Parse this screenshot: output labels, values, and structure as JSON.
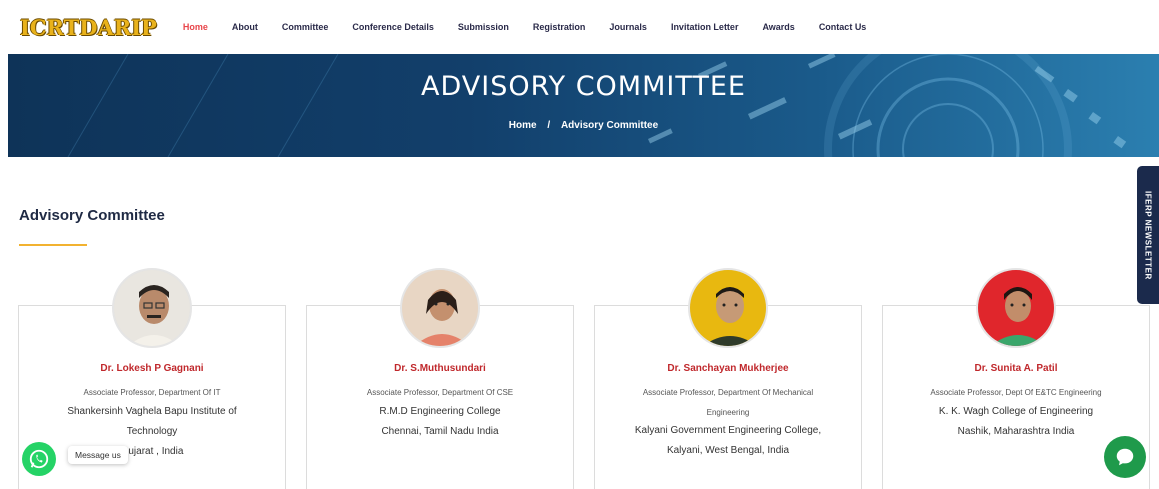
{
  "site": {
    "logo": "ICRTDARIP"
  },
  "nav": [
    {
      "label": "Home",
      "active": true
    },
    {
      "label": "About"
    },
    {
      "label": "Committee"
    },
    {
      "label": "Conference Details"
    },
    {
      "label": "Submission"
    },
    {
      "label": "Registration"
    },
    {
      "label": "Journals"
    },
    {
      "label": "Invitation Letter"
    },
    {
      "label": "Awards"
    },
    {
      "label": "Contact Us"
    }
  ],
  "banner": {
    "title": "ADVISORY COMMITTEE",
    "breadcrumb_home": "Home",
    "breadcrumb_sep": "/",
    "breadcrumb_current": "Advisory Committee"
  },
  "section": {
    "title": "Advisory Committee"
  },
  "members": [
    {
      "name": "Dr. Lokesh P Gagnani",
      "role": [
        "Associate Professor, Department Of IT"
      ],
      "inst": [
        "Shankersinh Vaghela Bapu Institute of",
        "Technology",
        "Gujarat , India"
      ]
    },
    {
      "name": "Dr. S.Muthusundari",
      "role": [
        "Associate Professor, Department Of CSE"
      ],
      "inst": [
        "R.M.D Engineering College",
        "Chennai, Tamil Nadu India"
      ]
    },
    {
      "name": "Dr. Sanchayan Mukherjee",
      "role": [
        "Associate Professor, Department Of Mechanical",
        "Engineering"
      ],
      "inst": [
        "Kalyani Government Engineering College,",
        "Kalyani, West Bengal, India"
      ]
    },
    {
      "name": "Dr. Sunita A. Patil",
      "role": [
        "Associate Professor, Dept Of E&TC Engineering"
      ],
      "inst": [
        "K. K. Wagh College of Engineering",
        "Nashik, Maharashtra India"
      ]
    }
  ],
  "sidebar_tab": {
    "label": "IFERP NEWSLETTER"
  },
  "whatsapp": {
    "label": "Message us",
    "icon": "whatsapp-icon"
  },
  "chat": {
    "icon": "chat-bubble-icon"
  },
  "colors": {
    "accent_red": "#e8454a",
    "name_red": "#c0282c",
    "gold": "#f2b230",
    "navy": "#1b2a4c",
    "whatsapp": "#25d366"
  }
}
